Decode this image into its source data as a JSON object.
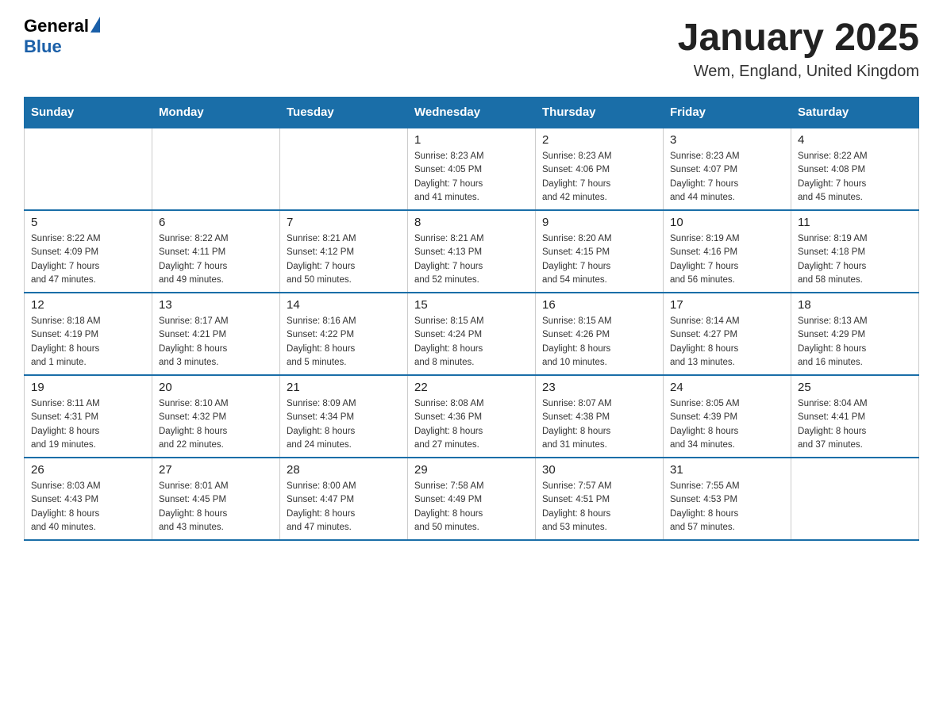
{
  "logo": {
    "general": "General",
    "blue": "Blue"
  },
  "title": "January 2025",
  "location": "Wem, England, United Kingdom",
  "days_of_week": [
    "Sunday",
    "Monday",
    "Tuesday",
    "Wednesday",
    "Thursday",
    "Friday",
    "Saturday"
  ],
  "weeks": [
    [
      {
        "day": "",
        "info": ""
      },
      {
        "day": "",
        "info": ""
      },
      {
        "day": "",
        "info": ""
      },
      {
        "day": "1",
        "info": "Sunrise: 8:23 AM\nSunset: 4:05 PM\nDaylight: 7 hours\nand 41 minutes."
      },
      {
        "day": "2",
        "info": "Sunrise: 8:23 AM\nSunset: 4:06 PM\nDaylight: 7 hours\nand 42 minutes."
      },
      {
        "day": "3",
        "info": "Sunrise: 8:23 AM\nSunset: 4:07 PM\nDaylight: 7 hours\nand 44 minutes."
      },
      {
        "day": "4",
        "info": "Sunrise: 8:22 AM\nSunset: 4:08 PM\nDaylight: 7 hours\nand 45 minutes."
      }
    ],
    [
      {
        "day": "5",
        "info": "Sunrise: 8:22 AM\nSunset: 4:09 PM\nDaylight: 7 hours\nand 47 minutes."
      },
      {
        "day": "6",
        "info": "Sunrise: 8:22 AM\nSunset: 4:11 PM\nDaylight: 7 hours\nand 49 minutes."
      },
      {
        "day": "7",
        "info": "Sunrise: 8:21 AM\nSunset: 4:12 PM\nDaylight: 7 hours\nand 50 minutes."
      },
      {
        "day": "8",
        "info": "Sunrise: 8:21 AM\nSunset: 4:13 PM\nDaylight: 7 hours\nand 52 minutes."
      },
      {
        "day": "9",
        "info": "Sunrise: 8:20 AM\nSunset: 4:15 PM\nDaylight: 7 hours\nand 54 minutes."
      },
      {
        "day": "10",
        "info": "Sunrise: 8:19 AM\nSunset: 4:16 PM\nDaylight: 7 hours\nand 56 minutes."
      },
      {
        "day": "11",
        "info": "Sunrise: 8:19 AM\nSunset: 4:18 PM\nDaylight: 7 hours\nand 58 minutes."
      }
    ],
    [
      {
        "day": "12",
        "info": "Sunrise: 8:18 AM\nSunset: 4:19 PM\nDaylight: 8 hours\nand 1 minute."
      },
      {
        "day": "13",
        "info": "Sunrise: 8:17 AM\nSunset: 4:21 PM\nDaylight: 8 hours\nand 3 minutes."
      },
      {
        "day": "14",
        "info": "Sunrise: 8:16 AM\nSunset: 4:22 PM\nDaylight: 8 hours\nand 5 minutes."
      },
      {
        "day": "15",
        "info": "Sunrise: 8:15 AM\nSunset: 4:24 PM\nDaylight: 8 hours\nand 8 minutes."
      },
      {
        "day": "16",
        "info": "Sunrise: 8:15 AM\nSunset: 4:26 PM\nDaylight: 8 hours\nand 10 minutes."
      },
      {
        "day": "17",
        "info": "Sunrise: 8:14 AM\nSunset: 4:27 PM\nDaylight: 8 hours\nand 13 minutes."
      },
      {
        "day": "18",
        "info": "Sunrise: 8:13 AM\nSunset: 4:29 PM\nDaylight: 8 hours\nand 16 minutes."
      }
    ],
    [
      {
        "day": "19",
        "info": "Sunrise: 8:11 AM\nSunset: 4:31 PM\nDaylight: 8 hours\nand 19 minutes."
      },
      {
        "day": "20",
        "info": "Sunrise: 8:10 AM\nSunset: 4:32 PM\nDaylight: 8 hours\nand 22 minutes."
      },
      {
        "day": "21",
        "info": "Sunrise: 8:09 AM\nSunset: 4:34 PM\nDaylight: 8 hours\nand 24 minutes."
      },
      {
        "day": "22",
        "info": "Sunrise: 8:08 AM\nSunset: 4:36 PM\nDaylight: 8 hours\nand 27 minutes."
      },
      {
        "day": "23",
        "info": "Sunrise: 8:07 AM\nSunset: 4:38 PM\nDaylight: 8 hours\nand 31 minutes."
      },
      {
        "day": "24",
        "info": "Sunrise: 8:05 AM\nSunset: 4:39 PM\nDaylight: 8 hours\nand 34 minutes."
      },
      {
        "day": "25",
        "info": "Sunrise: 8:04 AM\nSunset: 4:41 PM\nDaylight: 8 hours\nand 37 minutes."
      }
    ],
    [
      {
        "day": "26",
        "info": "Sunrise: 8:03 AM\nSunset: 4:43 PM\nDaylight: 8 hours\nand 40 minutes."
      },
      {
        "day": "27",
        "info": "Sunrise: 8:01 AM\nSunset: 4:45 PM\nDaylight: 8 hours\nand 43 minutes."
      },
      {
        "day": "28",
        "info": "Sunrise: 8:00 AM\nSunset: 4:47 PM\nDaylight: 8 hours\nand 47 minutes."
      },
      {
        "day": "29",
        "info": "Sunrise: 7:58 AM\nSunset: 4:49 PM\nDaylight: 8 hours\nand 50 minutes."
      },
      {
        "day": "30",
        "info": "Sunrise: 7:57 AM\nSunset: 4:51 PM\nDaylight: 8 hours\nand 53 minutes."
      },
      {
        "day": "31",
        "info": "Sunrise: 7:55 AM\nSunset: 4:53 PM\nDaylight: 8 hours\nand 57 minutes."
      },
      {
        "day": "",
        "info": ""
      }
    ]
  ]
}
